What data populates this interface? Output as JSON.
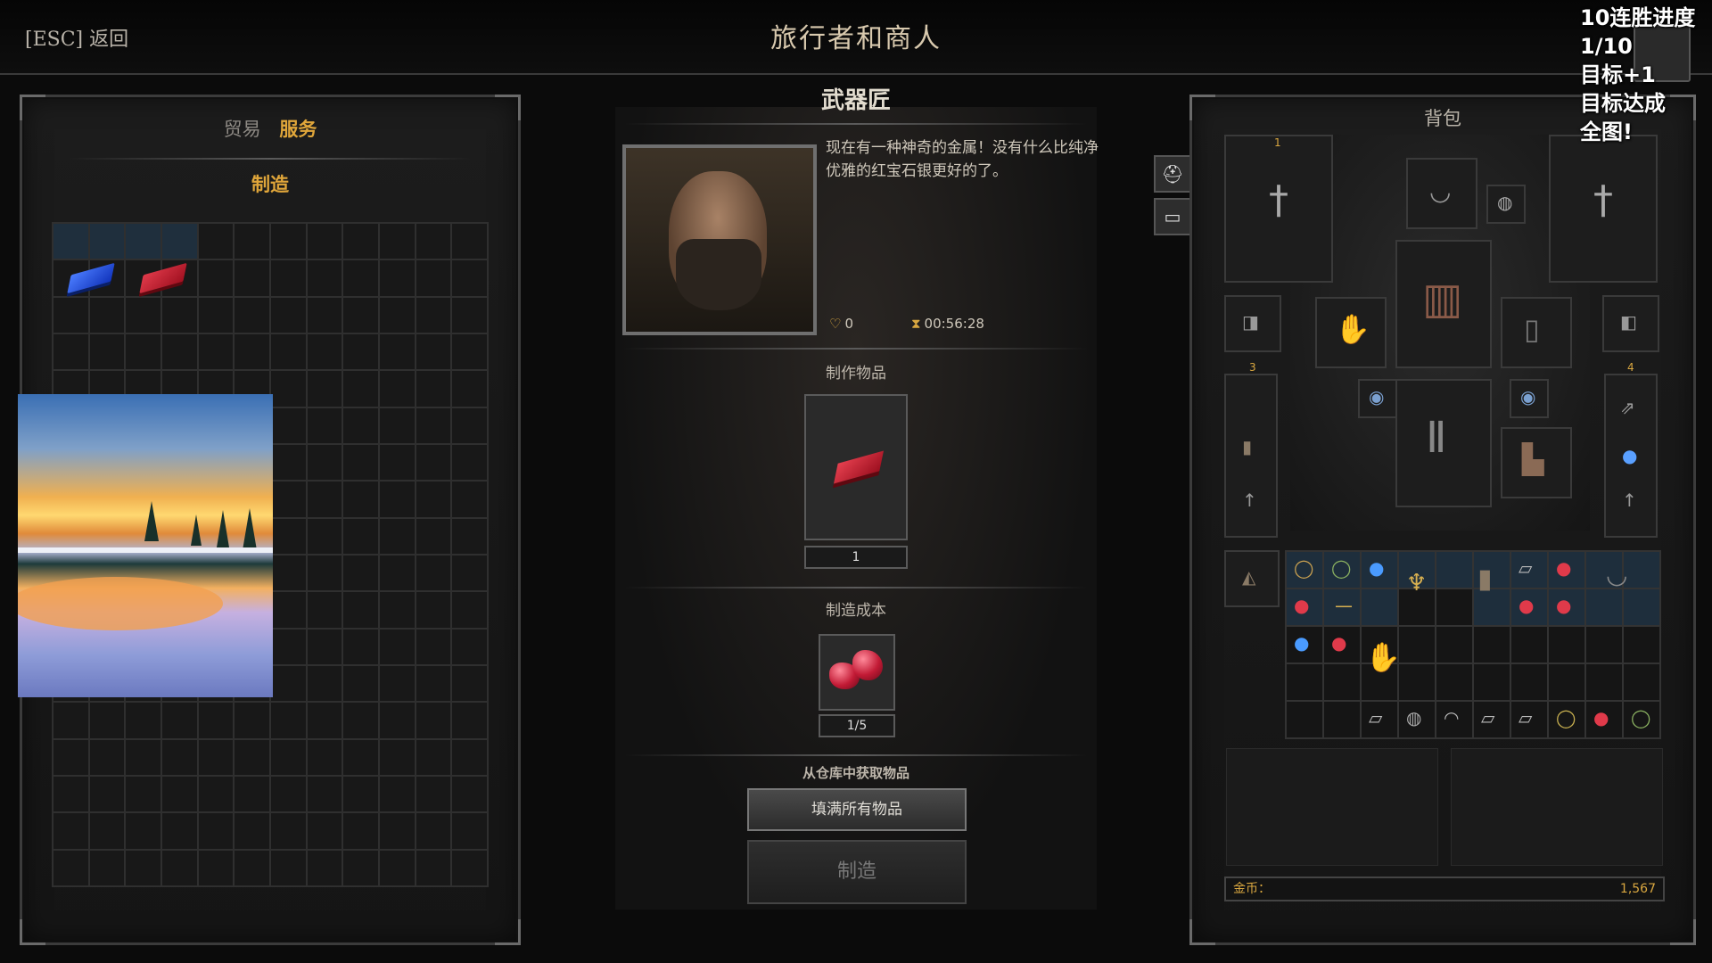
{
  "header": {
    "back_label": "[ESC] 返回",
    "title": "旅行者和商人"
  },
  "streak": {
    "line1": "10连胜进度",
    "line2": "1/10",
    "line3": "目标+1",
    "line4": "目标达成",
    "line5": "全图!"
  },
  "left_panel": {
    "tab_trade": "贸易",
    "tab_service": "服务",
    "section_label": "制造",
    "grid_items": [
      "blue-ingot-icon",
      "red-ingot-icon"
    ]
  },
  "npc": {
    "name": "武器匠",
    "dialogue": "现在有一种神奇的金属！没有什么比纯净优雅的红宝石银更好的了。",
    "reputation": "0",
    "timer": "00:56:28"
  },
  "crafting": {
    "item_label": "制作物品",
    "item_icon": "ruby-silver-ingot-icon",
    "item_qty": "1",
    "cost_label": "制造成本",
    "cost_icon": "ruby-gem-icon",
    "cost_qty": "1/5",
    "warehouse_label": "从仓库中获取物品",
    "fill_button": "填满所有物品",
    "craft_button": "制造"
  },
  "backpack": {
    "title": "背包",
    "slot_label_1": "1",
    "slot_label_3": "3",
    "slot_label_4": "4",
    "gold_label": "金币：",
    "gold_value": "1,567"
  },
  "colors": {
    "accent_gold": "#e0a63a",
    "ruby_red": "#c21a35",
    "blue_ingot": "#2f5fe8"
  }
}
